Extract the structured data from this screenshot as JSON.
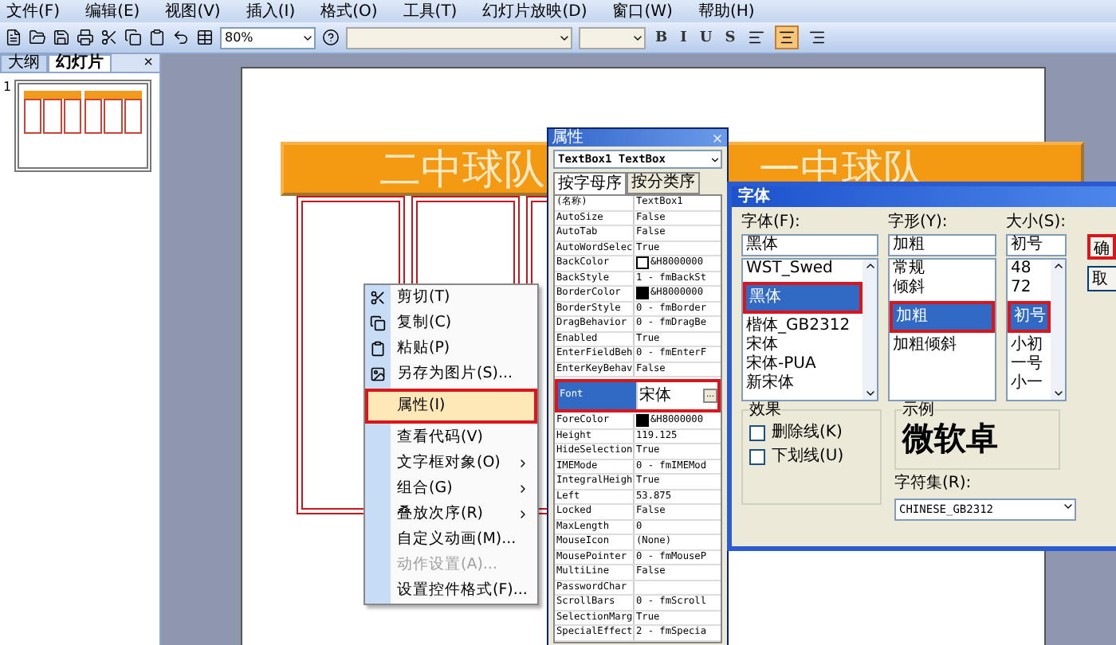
{
  "menu_bar": [
    "文件(F)",
    "编辑(E)",
    "视图(V)",
    "插入(I)",
    "格式(O)",
    "工具(T)",
    "幻灯片放映(D)",
    "窗口(W)",
    "帮助(H)"
  ],
  "toolbar": {
    "zoom": "80%",
    "format_buttons": [
      "B",
      "I",
      "U",
      "S"
    ],
    "alignment": [
      {
        "selected": false
      },
      {
        "selected": true
      },
      {
        "selected": false
      }
    ]
  },
  "side_panel": {
    "tabs": [
      {
        "label": "大纲",
        "selected": false
      },
      {
        "label": "幻灯片",
        "selected": true
      }
    ],
    "close": "×",
    "slide_number": "1"
  },
  "slide": {
    "titles": [
      "二中球队",
      "一中球队"
    ]
  },
  "context_menu": {
    "items": [
      {
        "label": "剪切(T)",
        "kind": "item",
        "selected": false,
        "disabled": false,
        "annotated": false
      },
      {
        "label": "复制(C)",
        "kind": "item",
        "selected": false,
        "disabled": false,
        "annotated": false
      },
      {
        "label": "粘贴(P)",
        "kind": "item",
        "selected": false,
        "disabled": false,
        "annotated": false
      },
      {
        "label": "另存为图片(S)...",
        "kind": "item",
        "selected": false,
        "disabled": false,
        "annotated": false
      },
      {
        "label": "属性(I)",
        "kind": "item",
        "selected": true,
        "disabled": false,
        "annotated": true
      },
      {
        "label": "查看代码(V)",
        "kind": "item",
        "selected": false,
        "disabled": false,
        "annotated": false
      },
      {
        "label": "文字框对象(O)",
        "kind": "submenu",
        "selected": false,
        "disabled": false,
        "annotated": false
      },
      {
        "label": "组合(G)",
        "kind": "submenu",
        "selected": false,
        "disabled": false,
        "annotated": false
      },
      {
        "label": "叠放次序(R)",
        "kind": "submenu",
        "selected": false,
        "disabled": false,
        "annotated": false
      },
      {
        "label": "自定义动画(M)...",
        "kind": "item",
        "selected": false,
        "disabled": false,
        "annotated": false
      },
      {
        "label": "动作设置(A)...",
        "kind": "item",
        "selected": false,
        "disabled": true,
        "annotated": false
      },
      {
        "label": "设置控件格式(F)...",
        "kind": "item",
        "selected": false,
        "disabled": false,
        "annotated": false
      }
    ]
  },
  "properties": {
    "title": "属性",
    "object": "TextBox1 TextBox",
    "tabs": [
      {
        "label": "按字母序",
        "selected": true
      },
      {
        "label": "按分类序",
        "selected": false
      }
    ],
    "rows": [
      {
        "name": "(名称)",
        "value": "TextBox1",
        "selected": false,
        "annotated": false
      },
      {
        "name": "AutoSize",
        "value": "False",
        "selected": false,
        "annotated": false
      },
      {
        "name": "AutoTab",
        "value": "False",
        "selected": false,
        "annotated": false
      },
      {
        "name": "AutoWordSelec",
        "value": "True",
        "selected": false,
        "annotated": false
      },
      {
        "name": "BackColor",
        "value": "&H8000000",
        "color": "#ffffff",
        "selected": false,
        "annotated": false
      },
      {
        "name": "BackStyle",
        "value": "1 - fmBackSt",
        "selected": false,
        "annotated": false
      },
      {
        "name": "BorderColor",
        "value": "&H8000000",
        "color": "#000000",
        "selected": false,
        "annotated": false
      },
      {
        "name": "BorderStyle",
        "value": "0 - fmBorder",
        "selected": false,
        "annotated": false
      },
      {
        "name": "DragBehavior",
        "value": "0 - fmDragBe",
        "selected": false,
        "annotated": false
      },
      {
        "name": "Enabled",
        "value": "True",
        "selected": false,
        "annotated": false
      },
      {
        "name": "EnterFieldBeh",
        "value": "0 - fmEnterF",
        "selected": false,
        "annotated": false
      },
      {
        "name": "EnterKeyBehav",
        "value": "False",
        "selected": false,
        "annotated": false
      },
      {
        "name": "Font",
        "value": "宋体",
        "selected": true,
        "annotated": true,
        "ellipsis": "..."
      },
      {
        "name": "ForeColor",
        "value": "&H8000000",
        "color": "#000000",
        "selected": false,
        "annotated": false
      },
      {
        "name": "Height",
        "value": "119.125",
        "selected": false,
        "annotated": false
      },
      {
        "name": "HideSelection",
        "value": "True",
        "selected": false,
        "annotated": false
      },
      {
        "name": "IMEMode",
        "value": "0 - fmIMEMod",
        "selected": false,
        "annotated": false
      },
      {
        "name": "IntegralHeigh",
        "value": "True",
        "selected": false,
        "annotated": false
      },
      {
        "name": "Left",
        "value": "53.875",
        "selected": false,
        "annotated": false
      },
      {
        "name": "Locked",
        "value": "False",
        "selected": false,
        "annotated": false
      },
      {
        "name": "MaxLength",
        "value": "0",
        "selected": false,
        "annotated": false
      },
      {
        "name": "MouseIcon",
        "value": "(None)",
        "selected": false,
        "annotated": false
      },
      {
        "name": "MousePointer",
        "value": "0 - fmMouseP",
        "selected": false,
        "annotated": false
      },
      {
        "name": "MultiLine",
        "value": "False",
        "selected": false,
        "annotated": false
      },
      {
        "name": "PasswordChar",
        "value": "",
        "selected": false,
        "annotated": false
      },
      {
        "name": "ScrollBars",
        "value": "0 - fmScroll",
        "selected": false,
        "annotated": false
      },
      {
        "name": "SelectionMarg",
        "value": "True",
        "selected": false,
        "annotated": false
      },
      {
        "name": "SpecialEffect",
        "value": "2 - fmSpecia",
        "selected": false,
        "annotated": false
      }
    ]
  },
  "font_dialog": {
    "title": "字体",
    "columns": [
      {
        "label": "字体(F):",
        "value": "黑体",
        "scrollbar": true,
        "items": [
          {
            "label": "WST_Swed",
            "selected": false,
            "annotated": false
          },
          {
            "label": "黑体",
            "selected": true,
            "annotated": true
          },
          {
            "label": "楷体_GB2312",
            "selected": false,
            "annotated": false
          },
          {
            "label": "宋体",
            "selected": false,
            "annotated": false
          },
          {
            "label": "宋体-PUA",
            "selected": false,
            "annotated": false
          },
          {
            "label": "新宋体",
            "selected": false,
            "annotated": false
          }
        ]
      },
      {
        "label": "字形(Y):",
        "value": "加粗",
        "scrollbar": false,
        "items": [
          {
            "label": "常规",
            "selected": false,
            "annotated": false
          },
          {
            "label": "倾斜",
            "selected": false,
            "annotated": false
          },
          {
            "label": "加粗",
            "selected": true,
            "annotated": true
          },
          {
            "label": "加粗倾斜",
            "selected": false,
            "annotated": false
          }
        ]
      },
      {
        "label": "大小(S):",
        "value": "初号",
        "scrollbar": true,
        "items": [
          {
            "label": "48",
            "selected": false,
            "annotated": false
          },
          {
            "label": "72",
            "selected": false,
            "annotated": false
          },
          {
            "label": "初号",
            "selected": true,
            "annotated": true
          },
          {
            "label": "小初",
            "selected": false,
            "annotated": false
          },
          {
            "label": "一号",
            "selected": false,
            "annotated": false
          },
          {
            "label": "小一",
            "selected": false,
            "annotated": false
          }
        ]
      }
    ],
    "buttons": [
      {
        "label": "确",
        "annotated": true
      },
      {
        "label": "取",
        "annotated": false
      }
    ],
    "effects": {
      "label": "效果",
      "options": [
        {
          "label": "删除线(K)",
          "checked": false
        },
        {
          "label": "下划线(U)",
          "checked": false
        }
      ]
    },
    "sample": {
      "label": "示例",
      "text": "微软卓"
    },
    "charset": {
      "label": "字符集(R):",
      "value": "CHINESE_GB2312"
    }
  }
}
